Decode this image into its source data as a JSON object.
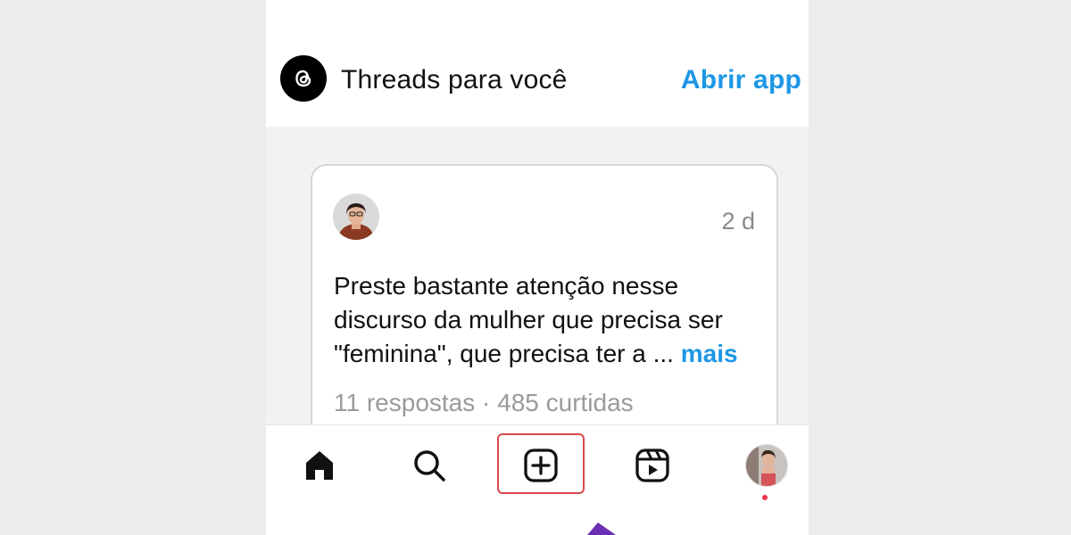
{
  "banner": {
    "title": "Threads para você",
    "open_app_label": "Abrir app",
    "logo_icon": "threads-logo-icon"
  },
  "post": {
    "timestamp": "2 d",
    "text": "Preste bastante atenção nesse discurso da mulher que precisa ser \"feminina\", que precisa ter a ... ",
    "more_label": "mais",
    "stats": "11 respostas · 485 curtidas"
  },
  "nav": {
    "items": [
      {
        "name": "home",
        "icon": "home-icon"
      },
      {
        "name": "search",
        "icon": "search-icon"
      },
      {
        "name": "create",
        "icon": "plus-square-icon",
        "highlighted": true
      },
      {
        "name": "reels",
        "icon": "reels-icon"
      },
      {
        "name": "profile",
        "icon": "avatar"
      }
    ]
  },
  "colors": {
    "accent_blue": "#1d97e6",
    "highlight_red": "#d8494b",
    "cursor_purple": "#6b2fb3"
  }
}
